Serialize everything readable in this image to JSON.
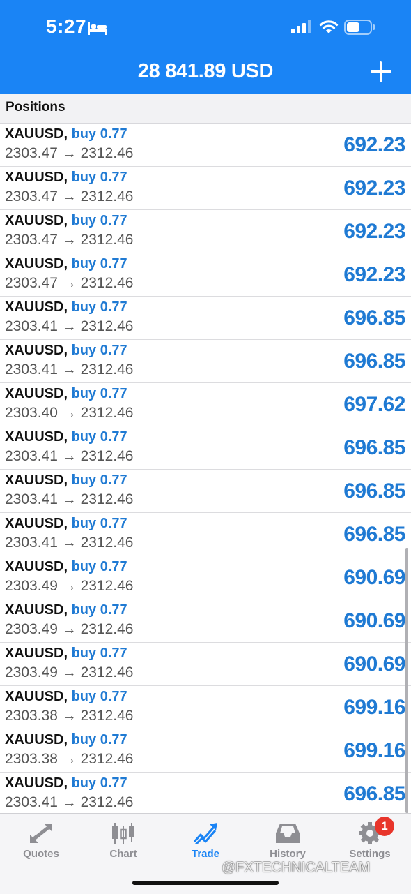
{
  "status": {
    "time": "5:27"
  },
  "header": {
    "balance": "28 841.89 USD",
    "add_icon": "plus-icon"
  },
  "section": {
    "title": "Positions"
  },
  "positions": [
    {
      "symbol": "XAUUSD,",
      "direction": "buy 0.77",
      "prices": "2303.47 → 2312.46",
      "profit": "692.23"
    },
    {
      "symbol": "XAUUSD,",
      "direction": "buy 0.77",
      "prices": "2303.47 → 2312.46",
      "profit": "692.23"
    },
    {
      "symbol": "XAUUSD,",
      "direction": "buy 0.77",
      "prices": "2303.47 → 2312.46",
      "profit": "692.23"
    },
    {
      "symbol": "XAUUSD,",
      "direction": "buy 0.77",
      "prices": "2303.47 → 2312.46",
      "profit": "692.23"
    },
    {
      "symbol": "XAUUSD,",
      "direction": "buy 0.77",
      "prices": "2303.41 → 2312.46",
      "profit": "696.85"
    },
    {
      "symbol": "XAUUSD,",
      "direction": "buy 0.77",
      "prices": "2303.41 → 2312.46",
      "profit": "696.85"
    },
    {
      "symbol": "XAUUSD,",
      "direction": "buy 0.77",
      "prices": "2303.40 → 2312.46",
      "profit": "697.62"
    },
    {
      "symbol": "XAUUSD,",
      "direction": "buy 0.77",
      "prices": "2303.41 → 2312.46",
      "profit": "696.85"
    },
    {
      "symbol": "XAUUSD,",
      "direction": "buy 0.77",
      "prices": "2303.41 → 2312.46",
      "profit": "696.85"
    },
    {
      "symbol": "XAUUSD,",
      "direction": "buy 0.77",
      "prices": "2303.41 → 2312.46",
      "profit": "696.85"
    },
    {
      "symbol": "XAUUSD,",
      "direction": "buy 0.77",
      "prices": "2303.49 → 2312.46",
      "profit": "690.69"
    },
    {
      "symbol": "XAUUSD,",
      "direction": "buy 0.77",
      "prices": "2303.49 → 2312.46",
      "profit": "690.69"
    },
    {
      "symbol": "XAUUSD,",
      "direction": "buy 0.77",
      "prices": "2303.49 → 2312.46",
      "profit": "690.69"
    },
    {
      "symbol": "XAUUSD,",
      "direction": "buy 0.77",
      "prices": "2303.38 → 2312.46",
      "profit": "699.16"
    },
    {
      "symbol": "XAUUSD,",
      "direction": "buy 0.77",
      "prices": "2303.38 → 2312.46",
      "profit": "699.16"
    },
    {
      "symbol": "XAUUSD,",
      "direction": "buy 0.77",
      "prices": "2303.41 → 2312.46",
      "profit": "696.85"
    }
  ],
  "tabs": [
    {
      "label": "Quotes",
      "icon": "quotes-arrows-icon"
    },
    {
      "label": "Chart",
      "icon": "candlestick-chart-icon"
    },
    {
      "label": "Trade",
      "icon": "trade-trend-icon",
      "active": true
    },
    {
      "label": "History",
      "icon": "inbox-tray-icon"
    },
    {
      "label": "Settings",
      "icon": "gear-icon"
    }
  ],
  "settings_badge": "1",
  "watermark": "@FXTECHNICALTEAM",
  "colors": {
    "accent": "#1a84f5",
    "profit": "#1f7ad3",
    "badge": "#e8352b"
  }
}
